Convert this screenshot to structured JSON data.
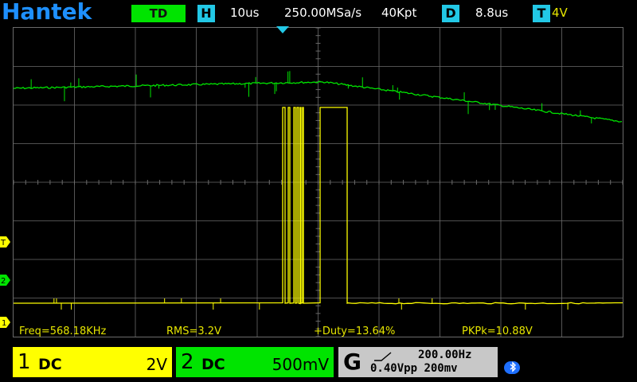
{
  "header": {
    "brand": "Hantek",
    "mode": "TD",
    "h_label": "H",
    "timebase": "10us",
    "sample_rate": "250.00MSa/s",
    "memory_depth": "40Kpt",
    "d_label": "D",
    "delay": "8.8us",
    "t_label": "T",
    "trigger_level": "4V"
  },
  "markers": {
    "trigger": "T",
    "ch2": "2",
    "ch1": "1"
  },
  "measurements": {
    "freq": "Freq=568.18KHz",
    "rms": "RMS=3.2V",
    "duty": "+Duty=13.64%",
    "pkpk": "PKPk=10.88V"
  },
  "channel1": {
    "number": "1",
    "coupling": "DC",
    "scale": "2V",
    "color": "#ffff00"
  },
  "channel2": {
    "number": "2",
    "coupling": "DC",
    "scale": "500mV",
    "color": "#00e400"
  },
  "generator": {
    "label": "G",
    "frequency": "200.00Hz",
    "amplitude": "0.40Vpp",
    "offset": "200mv"
  },
  "colors": {
    "brand": "#1e90ff",
    "ch1": "#ffff00",
    "ch2": "#00e400",
    "grid": "#6b6b6b",
    "badge_cyan": "#22c8e6"
  },
  "icons": {
    "bluetooth": "bluetooth-icon",
    "trigger_position": "trigger-position-icon"
  }
}
